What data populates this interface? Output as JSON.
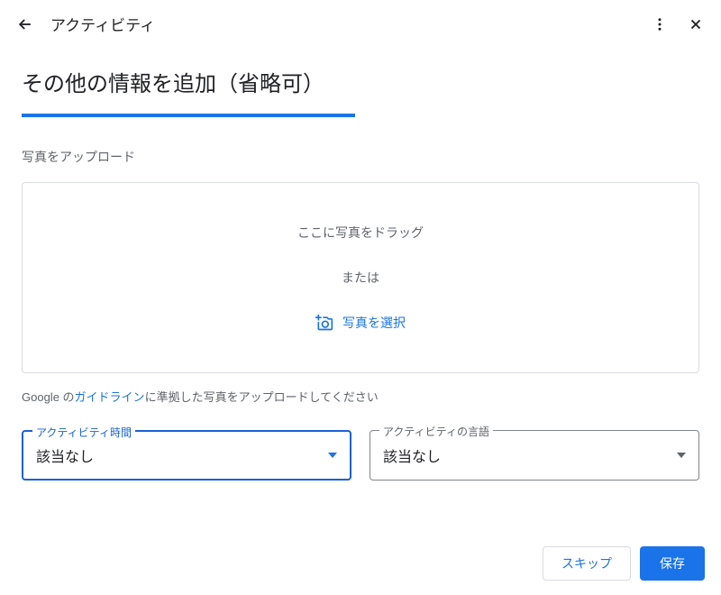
{
  "header": {
    "title": "アクティビティ"
  },
  "page": {
    "title": "その他の情報を追加（省略可）"
  },
  "upload": {
    "label": "写真をアップロード",
    "drag_text": "ここに写真をドラッグ",
    "or_text": "または",
    "select_text": "写真を選択"
  },
  "guideline": {
    "prefix": "Google の",
    "link": "ガイドライン",
    "suffix": "に準拠した写真をアップロードしてください"
  },
  "selects": {
    "duration": {
      "label": "アクティビティ時間",
      "value": "該当なし"
    },
    "language": {
      "label": "アクティビティの言語",
      "value": "該当なし"
    }
  },
  "footer": {
    "skip": "スキップ",
    "save": "保存"
  }
}
